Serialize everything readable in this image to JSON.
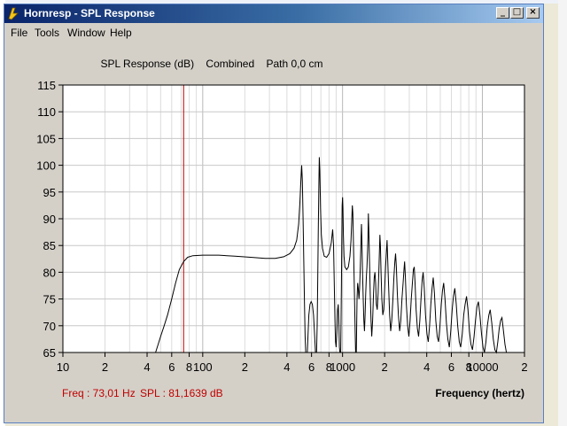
{
  "window": {
    "title": "Hornresp - SPL Response",
    "controls": {
      "minimize": "_",
      "maximize": "□",
      "close": "×"
    }
  },
  "menu": {
    "items": [
      "File",
      "Tools",
      "Window",
      "Help"
    ]
  },
  "chart_data": {
    "type": "line",
    "title": "SPL Response (dB)    Combined    Path 0,0 cm",
    "xlabel": "Frequency (hertz)",
    "ylabel": "",
    "x_scale": "log",
    "xlim": [
      10,
      20000
    ],
    "ylim": [
      65,
      115
    ],
    "y_ticks": [
      65,
      70,
      75,
      80,
      85,
      90,
      95,
      100,
      105,
      110,
      115
    ],
    "x_tick_labels": [
      {
        "value": 10,
        "label": "10"
      },
      {
        "value": 20,
        "label": "2"
      },
      {
        "value": 40,
        "label": "4"
      },
      {
        "value": 60,
        "label": "6"
      },
      {
        "value": 80,
        "label": "8"
      },
      {
        "value": 100,
        "label": "100"
      },
      {
        "value": 200,
        "label": "2"
      },
      {
        "value": 400,
        "label": "4"
      },
      {
        "value": 600,
        "label": "6"
      },
      {
        "value": 800,
        "label": "8"
      },
      {
        "value": 1000,
        "label": "1000"
      },
      {
        "value": 2000,
        "label": "2"
      },
      {
        "value": 4000,
        "label": "4"
      },
      {
        "value": 6000,
        "label": "6"
      },
      {
        "value": 8000,
        "label": "8"
      },
      {
        "value": 10000,
        "label": "10000"
      },
      {
        "value": 20000,
        "label": "2"
      }
    ],
    "grid": true,
    "cursor": {
      "frequency": 73.01,
      "spl": 81.1639
    },
    "readout": {
      "freq": "Freq : 73,01 Hz",
      "spl": "SPL : 81,1639 dB"
    },
    "series": [
      {
        "color": "#000000",
        "points": [
          [
            46,
            65
          ],
          [
            48,
            66.5
          ],
          [
            50,
            68
          ],
          [
            53,
            70
          ],
          [
            56,
            72
          ],
          [
            60,
            75
          ],
          [
            64,
            78
          ],
          [
            68,
            80.5
          ],
          [
            73,
            82
          ],
          [
            78,
            82.8
          ],
          [
            85,
            83.1
          ],
          [
            100,
            83.2
          ],
          [
            130,
            83.2
          ],
          [
            170,
            83.0
          ],
          [
            220,
            82.8
          ],
          [
            280,
            82.6
          ],
          [
            330,
            82.6
          ],
          [
            380,
            82.9
          ],
          [
            420,
            83.5
          ],
          [
            450,
            84.5
          ],
          [
            470,
            86
          ],
          [
            485,
            89
          ],
          [
            495,
            93
          ],
          [
            503,
            97
          ],
          [
            510,
            100
          ],
          [
            516,
            97
          ],
          [
            522,
            90
          ],
          [
            528,
            82
          ],
          [
            534,
            74
          ],
          [
            540,
            68
          ],
          [
            545,
            65
          ],
          [
            560,
            65
          ],
          [
            566,
            68
          ],
          [
            574,
            72
          ],
          [
            585,
            74
          ],
          [
            596,
            74.5
          ],
          [
            608,
            74
          ],
          [
            620,
            72
          ],
          [
            632,
            68
          ],
          [
            640,
            65
          ],
          [
            652,
            65
          ],
          [
            658,
            70
          ],
          [
            664,
            78
          ],
          [
            670,
            87
          ],
          [
            676,
            95
          ],
          [
            682,
            101.5
          ],
          [
            688,
            99
          ],
          [
            696,
            92
          ],
          [
            705,
            87
          ],
          [
            718,
            84.5
          ],
          [
            740,
            83
          ],
          [
            770,
            82.8
          ],
          [
            800,
            83.5
          ],
          [
            830,
            85.5
          ],
          [
            850,
            88
          ],
          [
            862,
            85
          ],
          [
            872,
            78
          ],
          [
            882,
            71
          ],
          [
            890,
            67
          ],
          [
            900,
            66
          ],
          [
            912,
            69
          ],
          [
            922,
            73
          ],
          [
            932,
            74
          ],
          [
            942,
            70
          ],
          [
            950,
            66
          ],
          [
            958,
            65
          ],
          [
            970,
            65
          ],
          [
            975,
            70
          ],
          [
            982,
            78
          ],
          [
            988,
            86
          ],
          [
            994,
            92.5
          ],
          [
            1000,
            94
          ],
          [
            1006,
            92
          ],
          [
            1014,
            87
          ],
          [
            1024,
            83
          ],
          [
            1040,
            81
          ],
          [
            1070,
            80.5
          ],
          [
            1100,
            81
          ],
          [
            1130,
            83
          ],
          [
            1150,
            86
          ],
          [
            1165,
            90
          ],
          [
            1175,
            92.5
          ],
          [
            1185,
            91
          ],
          [
            1195,
            86
          ],
          [
            1207,
            80
          ],
          [
            1220,
            74
          ],
          [
            1232,
            68
          ],
          [
            1240,
            65
          ],
          [
            1255,
            65
          ],
          [
            1262,
            70
          ],
          [
            1270,
            75
          ],
          [
            1282,
            78
          ],
          [
            1296,
            77
          ],
          [
            1310,
            75
          ],
          [
            1325,
            77
          ],
          [
            1340,
            81
          ],
          [
            1355,
            86
          ],
          [
            1366,
            89
          ],
          [
            1376,
            86
          ],
          [
            1390,
            80
          ],
          [
            1405,
            75
          ],
          [
            1420,
            71
          ],
          [
            1435,
            69
          ],
          [
            1450,
            72
          ],
          [
            1465,
            76
          ],
          [
            1480,
            79
          ],
          [
            1495,
            81
          ],
          [
            1510,
            84
          ],
          [
            1520,
            87
          ],
          [
            1530,
            91
          ],
          [
            1542,
            88
          ],
          [
            1558,
            82
          ],
          [
            1578,
            76
          ],
          [
            1598,
            71
          ],
          [
            1618,
            68
          ],
          [
            1640,
            71
          ],
          [
            1665,
            76
          ],
          [
            1685,
            79
          ],
          [
            1705,
            80
          ],
          [
            1725,
            78
          ],
          [
            1745,
            74
          ],
          [
            1770,
            73
          ],
          [
            1795,
            76
          ],
          [
            1818,
            80
          ],
          [
            1836,
            84
          ],
          [
            1850,
            87
          ],
          [
            1865,
            85
          ],
          [
            1885,
            80
          ],
          [
            1910,
            75
          ],
          [
            1940,
            72
          ],
          [
            1970,
            73
          ],
          [
            2000,
            77
          ],
          [
            2030,
            81
          ],
          [
            2060,
            84
          ],
          [
            2080,
            86
          ],
          [
            2100,
            83
          ],
          [
            2130,
            78
          ],
          [
            2170,
            72
          ],
          [
            2210,
            69
          ],
          [
            2250,
            71
          ],
          [
            2290,
            75
          ],
          [
            2330,
            79
          ],
          [
            2365,
            82
          ],
          [
            2395,
            83.5
          ],
          [
            2425,
            81
          ],
          [
            2465,
            76
          ],
          [
            2510,
            72
          ],
          [
            2560,
            69
          ],
          [
            2610,
            71
          ],
          [
            2660,
            75
          ],
          [
            2710,
            78
          ],
          [
            2750,
            80.5
          ],
          [
            2780,
            82
          ],
          [
            2815,
            79
          ],
          [
            2860,
            74
          ],
          [
            2920,
            70
          ],
          [
            2980,
            68
          ],
          [
            3040,
            71
          ],
          [
            3100,
            75
          ],
          [
            3160,
            78
          ],
          [
            3210,
            80.5
          ],
          [
            3255,
            81
          ],
          [
            3300,
            78
          ],
          [
            3360,
            73
          ],
          [
            3430,
            69.5
          ],
          [
            3500,
            68
          ],
          [
            3570,
            71
          ],
          [
            3640,
            75
          ],
          [
            3710,
            78.5
          ],
          [
            3770,
            80
          ],
          [
            3840,
            77
          ],
          [
            3920,
            72
          ],
          [
            4010,
            68.5
          ],
          [
            4100,
            67
          ],
          [
            4190,
            70
          ],
          [
            4280,
            74
          ],
          [
            4370,
            77
          ],
          [
            4450,
            79
          ],
          [
            4540,
            76
          ],
          [
            4640,
            71
          ],
          [
            4750,
            68
          ],
          [
            4860,
            67
          ],
          [
            4970,
            70
          ],
          [
            5080,
            74
          ],
          [
            5180,
            76.5
          ],
          [
            5290,
            78
          ],
          [
            5400,
            75
          ],
          [
            5530,
            70.5
          ],
          [
            5660,
            67.5
          ],
          [
            5800,
            66
          ],
          [
            5940,
            69
          ],
          [
            6080,
            73
          ],
          [
            6210,
            75.5
          ],
          [
            6350,
            77
          ],
          [
            6500,
            74
          ],
          [
            6660,
            70
          ],
          [
            6830,
            67
          ],
          [
            7000,
            66
          ],
          [
            7180,
            68.5
          ],
          [
            7350,
            72
          ],
          [
            7530,
            74
          ],
          [
            7700,
            75.5
          ],
          [
            7880,
            73
          ],
          [
            8080,
            69
          ],
          [
            8290,
            66.5
          ],
          [
            8500,
            65.5
          ],
          [
            8720,
            68
          ],
          [
            8930,
            71
          ],
          [
            9140,
            73.5
          ],
          [
            9360,
            74.5
          ],
          [
            9600,
            72
          ],
          [
            9850,
            68.5
          ],
          [
            10100,
            66
          ],
          [
            10350,
            65
          ],
          [
            10600,
            67
          ],
          [
            10860,
            70
          ],
          [
            11120,
            72
          ],
          [
            11380,
            73
          ],
          [
            11670,
            70.5
          ],
          [
            11970,
            67.5
          ],
          [
            12280,
            65.5
          ],
          [
            12600,
            65
          ],
          [
            12900,
            67
          ],
          [
            13200,
            69.5
          ],
          [
            13500,
            71
          ],
          [
            13800,
            71.5
          ],
          [
            14150,
            69
          ],
          [
            14500,
            66.5
          ],
          [
            14850,
            65
          ]
        ]
      }
    ]
  }
}
